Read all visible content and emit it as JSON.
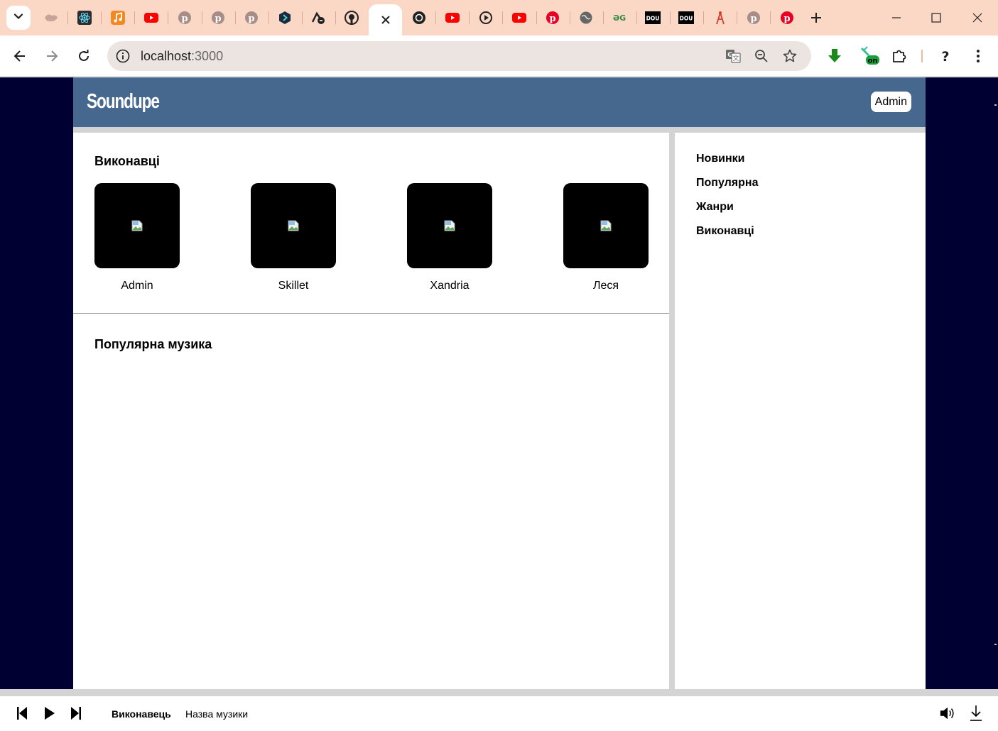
{
  "browser": {
    "tabs": [
      {
        "icon": "whale-icon",
        "color": "#c9a39a"
      },
      {
        "icon": "react-icon",
        "color": "#2d2d2d"
      },
      {
        "icon": "music-icon",
        "color": "#f4891f"
      },
      {
        "icon": "youtube-icon",
        "color": "#ff0000"
      },
      {
        "icon": "pinterest-icon",
        "color": "#a88c86"
      },
      {
        "icon": "pinterest-icon",
        "color": "#a88c86"
      },
      {
        "icon": "pinterest-icon",
        "color": "#a88c86"
      },
      {
        "icon": "hex-icon",
        "color": "#1a2a40"
      },
      {
        "icon": "dev-icon",
        "color": "#222222"
      },
      {
        "icon": "github-icon",
        "color": "#222222"
      },
      {
        "icon": "close-icon",
        "color": "#222222",
        "active": true
      },
      {
        "icon": "openai-icon",
        "color": "#222222"
      },
      {
        "icon": "youtube-icon",
        "color": "#ff0000"
      },
      {
        "icon": "play-circle-icon",
        "color": "#222222"
      },
      {
        "icon": "youtube-icon",
        "color": "#ff0000"
      },
      {
        "icon": "pinterest-icon",
        "color": "#e60023"
      },
      {
        "icon": "globe-icon",
        "color": "#666666"
      },
      {
        "icon": "geeksforgeeks-icon",
        "color": "#2f8d46"
      },
      {
        "icon": "dou-icon",
        "color": "#000000",
        "text": "DOU"
      },
      {
        "icon": "dou-icon",
        "color": "#000000",
        "text": "DOU"
      },
      {
        "icon": "tower-icon",
        "color": "#d43a2a"
      },
      {
        "icon": "pinterest-icon",
        "color": "#a88c86"
      },
      {
        "icon": "pinterest-icon",
        "color": "#e60023"
      }
    ],
    "url_host": "localhost",
    "url_port": ":3000",
    "ext_badge": "on"
  },
  "app": {
    "logo": "Soundupe",
    "user_button": "Admin",
    "colors": {
      "header": "#46688f",
      "background": "#000033",
      "panel_gap": "#d4d4d4"
    }
  },
  "main": {
    "artists_title": "Виконавці",
    "artists": [
      {
        "name": "Admin"
      },
      {
        "name": "Skillet"
      },
      {
        "name": "Xandria"
      },
      {
        "name": "Леся"
      }
    ],
    "popular_title": "Популярна музика"
  },
  "sidebar": {
    "links": [
      "Новинки",
      "Популярна",
      "Жанри",
      "Виконавці"
    ]
  },
  "player": {
    "artist": "Виконавець",
    "title": "Назва музики"
  }
}
